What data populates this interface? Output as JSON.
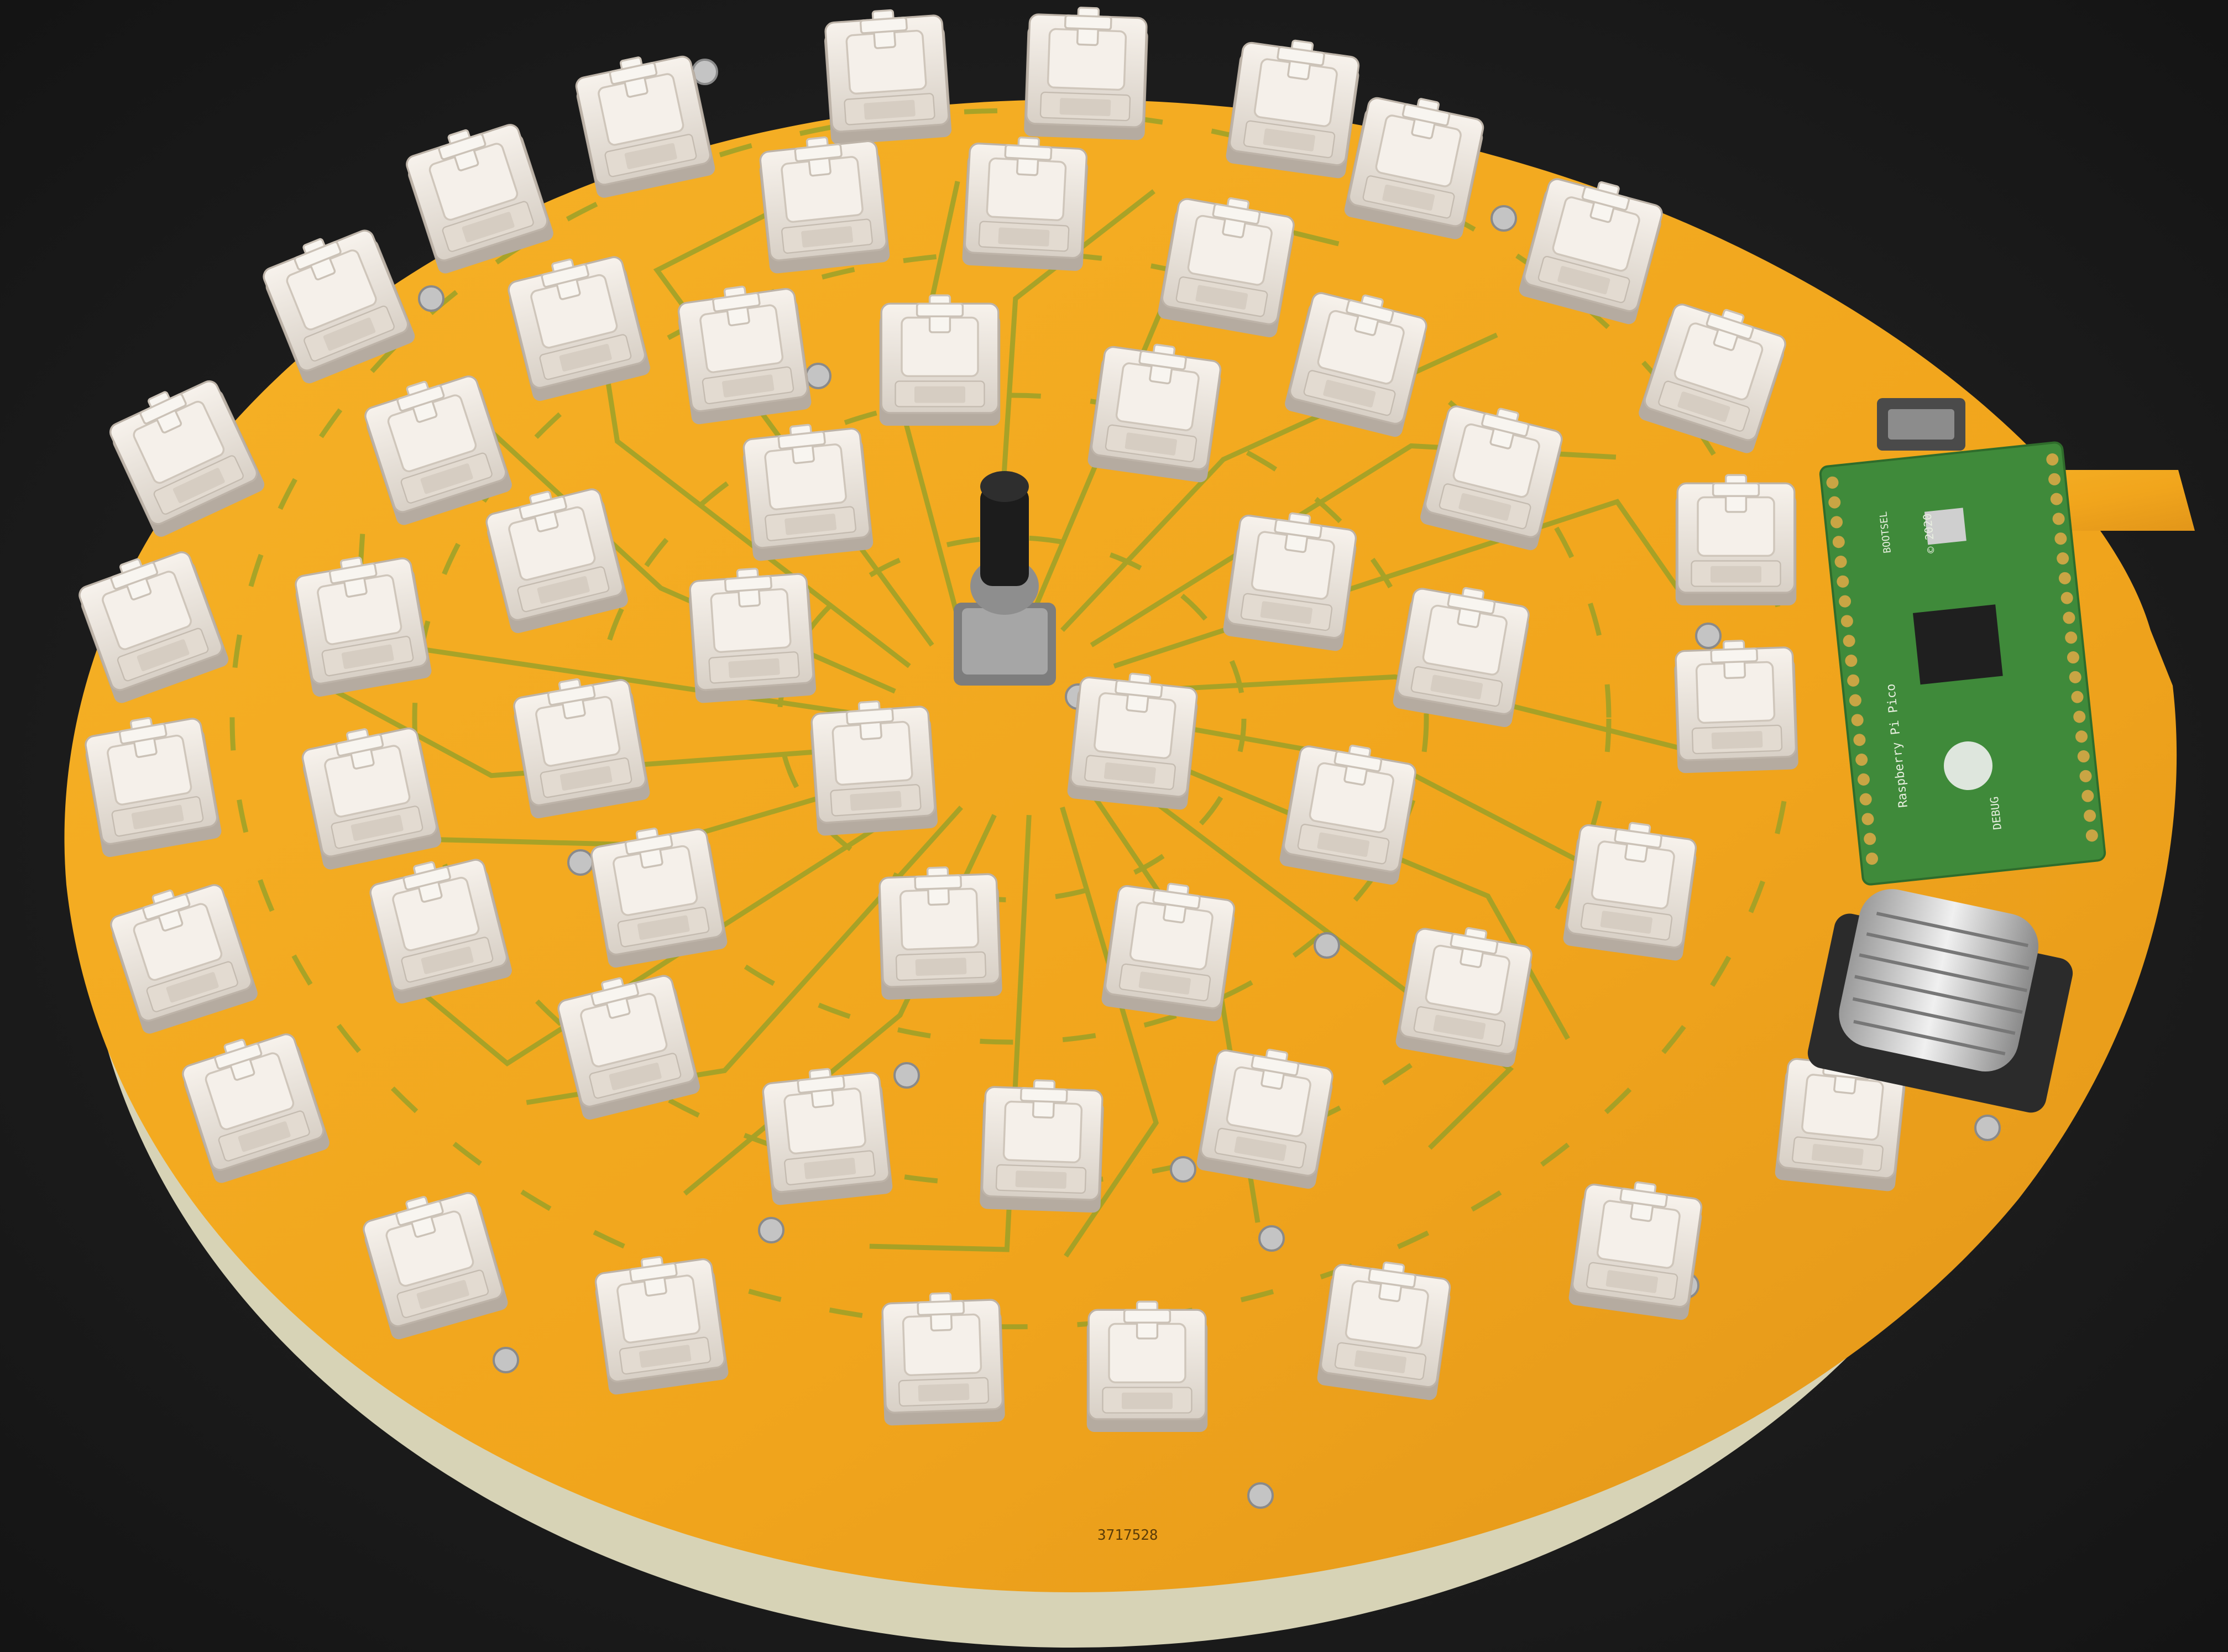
{
  "photo": {
    "subject": "circular-keyboard-pcb",
    "colors": {
      "background": "#1b1b1b",
      "board": "#f2a81f",
      "board_shadow": "#c98a17",
      "board_edge": "#d9d6b8",
      "trace": "#8fa02a",
      "switch_body": "#ece6de",
      "switch_shadow": "#b9b0a6",
      "switch_stem": "#f7f3ee",
      "pico_board": "#3f8a3a",
      "pin_gold": "#c9a544",
      "knob": "#1c1c1c",
      "knob_base": "#9c9c9c",
      "trackball_housing": "#2b2b2b",
      "trackball": "#d8d8d8",
      "screw": "#c4c4c4"
    }
  },
  "pcb_labels": {
    "pico_name": "Raspberry Pi Pico",
    "pico_year": "© 2020",
    "debug_label": "DEBUG",
    "bootsel_label": "BOOTSEL",
    "board_code": "3717528"
  },
  "components": {
    "rotary_encoder": "rotary-encoder",
    "trackball": "trackball-module",
    "microcontroller": "raspberry-pi-pico",
    "usb_connector": "usb-micro-connector"
  }
}
